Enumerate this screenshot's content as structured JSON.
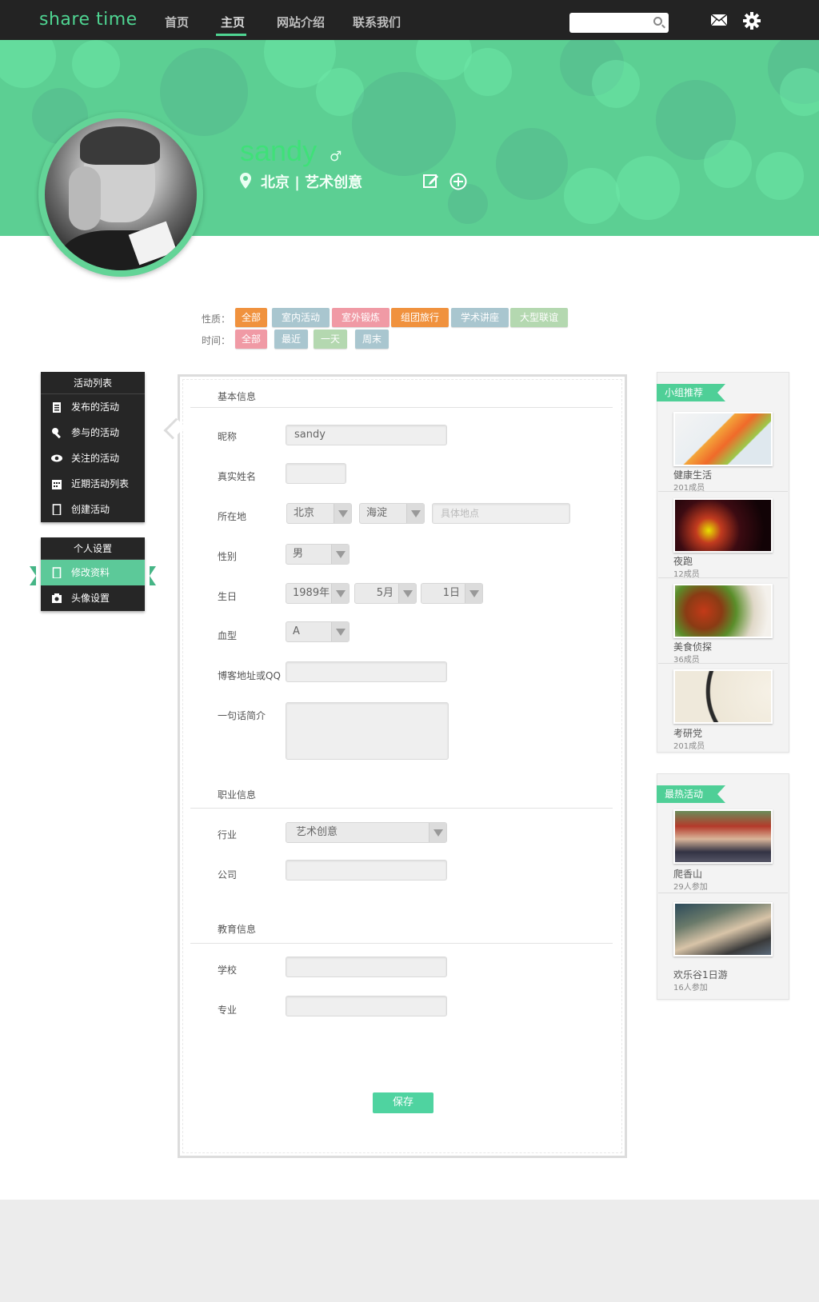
{
  "header": {
    "logo": "share time",
    "nav": [
      "首页",
      "主页",
      "网站介绍",
      "联系我们"
    ],
    "search_placeholder": ""
  },
  "profile": {
    "username": "sandy",
    "gender_symbol": "♂",
    "location": "北京 | 艺术创意"
  },
  "filters": {
    "nature_label": "性质：",
    "nature_tags": [
      "全部",
      "室内活动",
      "室外锻炼",
      "组团旅行",
      "学术讲座",
      "大型联谊"
    ],
    "time_label": "时间：",
    "time_tags": [
      "全部",
      "最近",
      "一天",
      "周末"
    ]
  },
  "activity_menu": {
    "title": "活动列表",
    "items": [
      "发布的活动",
      "参与的活动",
      "关注的活动",
      "近期活动列表",
      "创建活动"
    ]
  },
  "settings_menu": {
    "title": "个人设置",
    "items": [
      "修改资料",
      "头像设置"
    ]
  },
  "form": {
    "basic_title": "基本信息",
    "labels": {
      "nickname": "昵称",
      "realname": "真实姓名",
      "location": "所在地",
      "gender": "性别",
      "birthday": "生日",
      "blood": "血型",
      "blog": "博客地址或QQ",
      "intro": "一句话简介",
      "industry": "行业",
      "company": "公司",
      "school": "学校",
      "major": "专业"
    },
    "values": {
      "nickname": "sandy",
      "city": "北京",
      "district": "海淀",
      "address_placeholder": "具体地点",
      "gender": "男",
      "year": "1989年",
      "month": "5月",
      "day": "1日",
      "blood": "A",
      "industry": "艺术创意"
    },
    "career_title": "职业信息",
    "education_title": "教育信息",
    "save_label": "保存"
  },
  "groups": {
    "title": "小组推荐",
    "items": [
      {
        "name": "健康生活",
        "count": "201成员"
      },
      {
        "name": "夜跑",
        "count": "12成员"
      },
      {
        "name": "美食侦探",
        "count": "36成员"
      },
      {
        "name": "考研党",
        "count": "201成员"
      }
    ]
  },
  "hot": {
    "title": "最热活动",
    "items": [
      {
        "name": "爬香山",
        "count": "29人参加"
      },
      {
        "name": "欢乐谷1日游",
        "count": "16人参加"
      }
    ]
  },
  "colors": {
    "accent": "#4fd592",
    "banner": "#5ccf93",
    "tag_orange": "#f0923e",
    "tag_blue": "#a9c6cf",
    "tag_pink": "#f09aa5",
    "tag_green": "#b4d8b0"
  }
}
